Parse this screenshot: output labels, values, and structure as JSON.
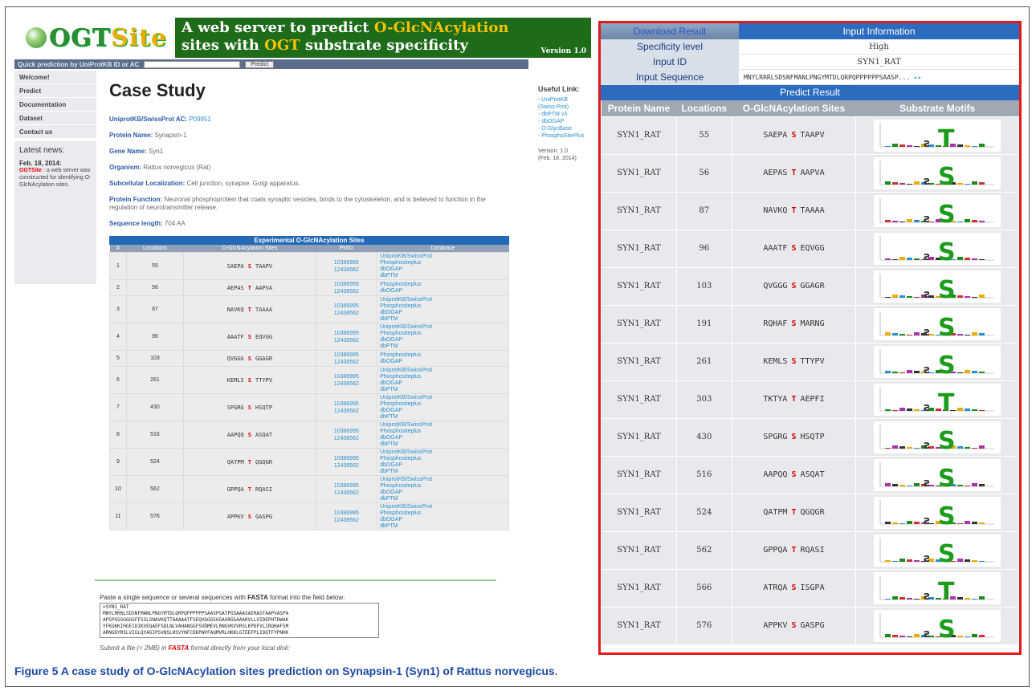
{
  "banner": {
    "logo_prefix": "OGT",
    "logo_suffix": "Site",
    "tagline_line1_a": "A web server to predict ",
    "tagline_line1_b": "O-GlcNAcylation",
    "tagline_line2_a": "sites with ",
    "tagline_line2_b": "OGT",
    "tagline_line2_c": " substrate specificity",
    "version": "Version 1.0"
  },
  "quick": {
    "label": "Quick prediction by UniProtKB ID or AC",
    "button": "Predict"
  },
  "sidebar": {
    "items": [
      "Welcome!",
      "Predict",
      "Documentation",
      "Dataset",
      "Contact us"
    ],
    "news_title": "Latest news:",
    "news_date": "Feb. 18, 2014:",
    "news_name": "OGTSite",
    "news_text": " : a web server was constructed for identifying O-GlcNAcylation sites."
  },
  "case": {
    "title": "Case Study",
    "ac_label": "UniprotKB/SwissProt AC:",
    "ac_value": "P09951",
    "protein_label": "Protein Name:",
    "protein_value": "Synapsin-1",
    "gene_label": "Gene Name:",
    "gene_value": "Syn1",
    "org_label": "Organism:",
    "org_value": "Rattus norvegicus (Rat)",
    "loc_label": "Subcellular Localization:",
    "loc_value": "Cell junction, synapse. Golgi apparatus.",
    "func_label": "Protein Function:",
    "func_value": "Neuronal phosphoprotein that coats synaptic vesicles, binds to the cytoskeleton, and is believed to function in the regulation of neurotransmitter release.",
    "len_label": "Sequence length:",
    "len_value": "704 AA"
  },
  "exp": {
    "caption": "Experimental O-GlcNAcylation Sites",
    "headers": [
      "#",
      "Locations",
      "O-GlcNAcylation Sites",
      "PMID",
      "Database"
    ],
    "rows": [
      {
        "n": "1",
        "loc": "55",
        "l": "SAEPA",
        "r": "S",
        "rr": "TAAPV",
        "pm": [
          "10386995",
          "12438562"
        ],
        "db": [
          "UniprotKB/SwissProt",
          "Phosphositeplus",
          "dbOGAP",
          "dbPTM"
        ]
      },
      {
        "n": "2",
        "loc": "56",
        "l": "AEPAS",
        "r": "T",
        "rr": "AAPVA",
        "pm": [
          "10386995",
          "12438562"
        ],
        "db": [
          "Phosphositeplus",
          "dbOGAP"
        ]
      },
      {
        "n": "3",
        "loc": "87",
        "l": "NAVKQ",
        "r": "T",
        "rr": "TAAAA",
        "pm": [
          "10386995",
          "12438562"
        ],
        "db": [
          "UniprotKB/SwissProt",
          "Phosphositeplus",
          "dbOGAP",
          "dbPTM"
        ]
      },
      {
        "n": "4",
        "loc": "96",
        "l": "AAATF",
        "r": "S",
        "rr": "EQVGG",
        "pm": [
          "10386995",
          "12438562"
        ],
        "db": [
          "UniprotKB/SwissProt",
          "Phosphositeplus",
          "dbOGAP",
          "dbPTM"
        ]
      },
      {
        "n": "5",
        "loc": "103",
        "l": "QVGGG",
        "r": "S",
        "rr": "GGAGR",
        "pm": [
          "10386995",
          "12438562"
        ],
        "db": [
          "Phosphositeplus",
          "dbOGAP"
        ]
      },
      {
        "n": "6",
        "loc": "261",
        "l": "KEMLS",
        "r": "S",
        "rr": "TTYPV",
        "pm": [
          "10386995",
          "12438562"
        ],
        "db": [
          "UniprotKB/SwissProt",
          "Phosphositeplus",
          "dbOGAP",
          "dbPTM"
        ]
      },
      {
        "n": "7",
        "loc": "430",
        "l": "SPGRG",
        "r": "S",
        "rr": "HSQTP",
        "pm": [
          "10386995",
          "12438562"
        ],
        "db": [
          "UniprotKB/SwissProt",
          "Phosphositeplus",
          "dbOGAP",
          "dbPTM"
        ]
      },
      {
        "n": "8",
        "loc": "516",
        "l": "AAPQQ",
        "r": "S",
        "rr": "ASQAT",
        "pm": [
          "10386995",
          "12438562"
        ],
        "db": [
          "UniprotKB/SwissProt",
          "Phosphositeplus",
          "dbOGAP",
          "dbPTM"
        ]
      },
      {
        "n": "9",
        "loc": "524",
        "l": "QATPM",
        "r": "T",
        "rr": "QGQGR",
        "pm": [
          "10386995",
          "12438562"
        ],
        "db": [
          "UniprotKB/SwissProt",
          "Phosphositeplus",
          "dbOGAP",
          "dbPTM"
        ]
      },
      {
        "n": "10",
        "loc": "562",
        "l": "GPPQA",
        "r": "T",
        "rr": "RQASI",
        "pm": [
          "10386995",
          "12438562"
        ],
        "db": [
          "UniprotKB/SwissProt",
          "Phosphositeplus",
          "dbOGAP",
          "dbPTM"
        ]
      },
      {
        "n": "11",
        "loc": "576",
        "l": "APPKV",
        "r": "S",
        "rr": "GASPG",
        "pm": [
          "10386995",
          "12438562"
        ],
        "db": [
          "UniprotKB/SwissProt",
          "Phosphositeplus",
          "dbOGAP",
          "dbPTM"
        ]
      }
    ]
  },
  "paste": {
    "prompt_a": "Paste a single sequence or several sequences with ",
    "prompt_b": "FASTA",
    "prompt_c": " format into the field below:",
    "sequence": ">SYN1_RAT\nMNYLRRRLSDSNFMANLPNGYMTDLQRPQPPPPPPSAASPGATPGSAAASAERASTAAPVASPA\nAPSPGSSGGGGFFSSLSNAVKQTTAAAAATFSEQVGGGSGGAGRGGAAARVLLVIDEPHTDWAK\nYFKGKKIHGEIDIKVEQAEFSDLNLVAHANGGFSVDMEVLRNGVKVVRSLKPDFVLIRQHAFSM\nARNGDYRSLVIGLQYAGIPSVNSLHSVYNFCDKPWVFAQMVRLHKKLGTEEFPLIDQTFYPNHK",
    "submit_a": "Submit a file (< 2MB) in ",
    "submit_b": "FASTA",
    "submit_c": " format directly from your local disk:"
  },
  "useful": {
    "title": "Useful Link:",
    "links": [
      "- UniProtKB",
      "(Swiss-Prot)",
      "- dbPTM v3",
      "- dbOGAP",
      "- O-GlycBase",
      "- PhosphoSitePlus"
    ],
    "version": "Version: 1.0",
    "version_date": "(Feb. 18, 2014)"
  },
  "result": {
    "download": "Download Result",
    "input_info": "Input Information",
    "spec_label": "Specificity level",
    "spec_value": "High",
    "id_label": "Input ID",
    "id_value": "SYN1_RAT",
    "seq_label": "Input Sequence",
    "seq_value": "MNYLRRRLSDSNFMANLPNGYMTDLQRPQPPPPPPSAASP...",
    "predict": "Predict Result",
    "headers": [
      "Protein Name",
      "Locations",
      "O-GlcNAcylation Sites",
      "Substrate Motifs"
    ],
    "rows": [
      {
        "name": "SYN1_RAT",
        "loc": "55",
        "l": "SAEPA",
        "r": "S",
        "rr": "TAAPV",
        "motif": "T"
      },
      {
        "name": "SYN1_RAT",
        "loc": "56",
        "l": "AEPAS",
        "r": "T",
        "rr": "AAPVA",
        "motif": "S"
      },
      {
        "name": "SYN1_RAT",
        "loc": "87",
        "l": "NAVKQ",
        "r": "T",
        "rr": "TAAAA",
        "motif": "S"
      },
      {
        "name": "SYN1_RAT",
        "loc": "96",
        "l": "AAATF",
        "r": "S",
        "rr": "EQVGG",
        "motif": "S"
      },
      {
        "name": "SYN1_RAT",
        "loc": "103",
        "l": "QVGGG",
        "r": "S",
        "rr": "GGAGR",
        "motif": "S"
      },
      {
        "name": "SYN1_RAT",
        "loc": "191",
        "l": "RQHAF",
        "r": "S",
        "rr": "MARNG",
        "motif": "S"
      },
      {
        "name": "SYN1_RAT",
        "loc": "261",
        "l": "KEMLS",
        "r": "S",
        "rr": "TTYPV",
        "motif": "S"
      },
      {
        "name": "SYN1_RAT",
        "loc": "303",
        "l": "TKTYA",
        "r": "T",
        "rr": "AEPFI",
        "motif": "T"
      },
      {
        "name": "SYN1_RAT",
        "loc": "430",
        "l": "SPGRG",
        "r": "S",
        "rr": "HSQTP",
        "motif": "S"
      },
      {
        "name": "SYN1_RAT",
        "loc": "516",
        "l": "AAPQQ",
        "r": "S",
        "rr": "ASQAT",
        "motif": "S"
      },
      {
        "name": "SYN1_RAT",
        "loc": "524",
        "l": "QATPM",
        "r": "T",
        "rr": "QGQGR",
        "motif": "S"
      },
      {
        "name": "SYN1_RAT",
        "loc": "562",
        "l": "GPPQA",
        "r": "T",
        "rr": "RQASI",
        "motif": "S"
      },
      {
        "name": "SYN1_RAT",
        "loc": "566",
        "l": "ATRQA",
        "r": "S",
        "rr": "ISGPA",
        "motif": "T"
      },
      {
        "name": "SYN1_RAT",
        "loc": "576",
        "l": "APPKV",
        "r": "S",
        "rr": "GASPG",
        "motif": "S"
      }
    ]
  },
  "figure": {
    "label": "Figure 5",
    "text": " A case study of O-GlcNAcylation sites prediction on Synapsin-1 (Syn1) of Rattus norvegicus",
    "end": "."
  },
  "colors": {
    "accent_blue": "#2b6cbf",
    "red_border": "#e21a1a",
    "site_red": "#dd0000",
    "green": "#1c8c1c"
  }
}
